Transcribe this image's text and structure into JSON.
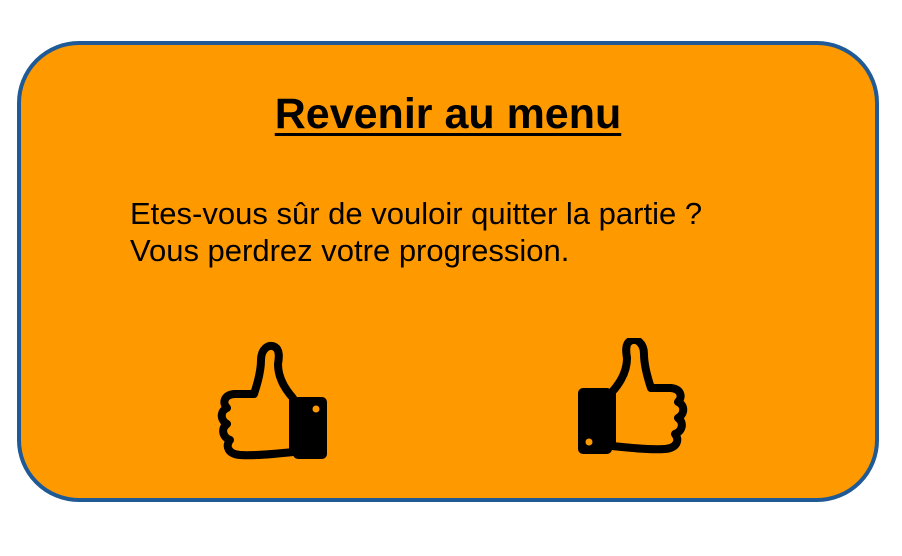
{
  "dialog": {
    "title": "Revenir au menu",
    "message_line1": "Etes-vous sûr de vouloir quitter la partie ?",
    "message_line2": "Vous perdrez votre progression.",
    "background_color": "#ff9900",
    "border_color": "#1f5a96"
  },
  "buttons": {
    "cancel_icon": "thumbs-down-icon",
    "confirm_icon": "thumbs-up-icon"
  }
}
